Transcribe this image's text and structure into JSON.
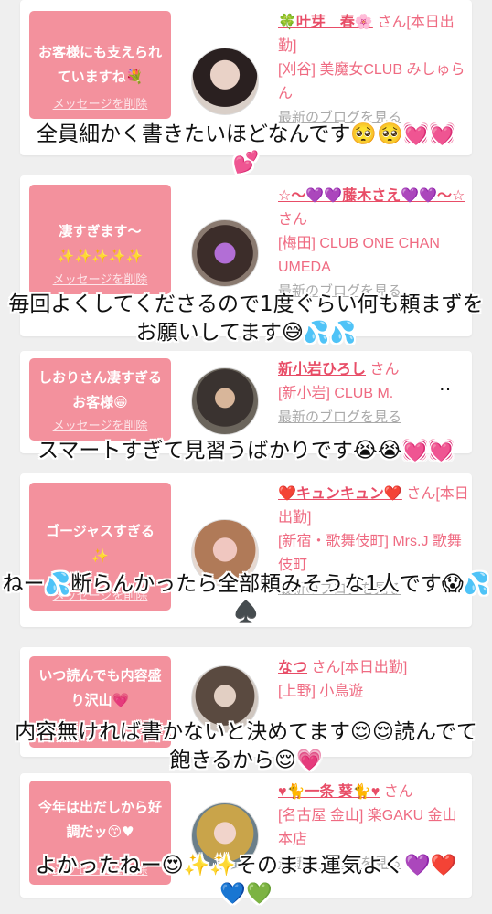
{
  "colors": {
    "bubble": "#f3919d",
    "name": "#e84d67",
    "text": "#ef6b82",
    "link": "#aaaaaa",
    "background": "#efefef"
  },
  "delete_label": "メッセージを削除",
  "blog_label": "最新のブログを見る",
  "san": "さん",
  "cards": [
    {
      "message": "お客様にも支えられていますね💐",
      "name": "🍀叶芽　春🌸",
      "status": "[本日出勤]",
      "shop": "[刈谷] 美魔女CLUB みしゅらん",
      "caption": "全員細かく書きたいほどなんです🥺🥺💓💓\n💕"
    },
    {
      "message": "凄すぎます〜\n✨✨✨✨✨",
      "name": "☆〜💜💜藤木さえ💜💜〜☆",
      "status": "",
      "shop": "[梅田] CLUB ONE CHAN UMEDA",
      "caption": "毎回よくしてくださるので1度ぐらい何も頼まずをお願いしてます😅💦💦"
    },
    {
      "message": "しおりさん凄すぎるお客様😁",
      "name": "新小岩ひろし",
      "status": "",
      "shop": "[新小岩] CLUB M.",
      "caption": "スマートすぎて見習うばかりです😭😭💓💓"
    },
    {
      "message": "ゴージャスすぎる\n✨",
      "name": "❤️キュンキュン❤️",
      "status": "[本日出勤]",
      "shop": "[新宿・歌舞伎町] Mrs.J 歌舞伎町",
      "caption": "ねー💦断らんかったら全部頼みそうな1人です😱💦♠️"
    },
    {
      "message": "いつ読んでも内容盛り沢山💗",
      "name": "なつ",
      "status": "[本日出勤]",
      "shop": "[上野] 小鳥遊",
      "caption": "内容無ければ書かないと決めてます😌😌読んでて飽きるから😌💗"
    },
    {
      "message": "今年は出だしから好調だッ😙♥",
      "name": "♥🐈一条 葵🐈♥",
      "status": "",
      "shop": "[名古屋 金山] 楽GAKU 金山本店",
      "caption": "よかったねー😍✨✨そのまま運気よく💜❤️\n💙💚"
    }
  ]
}
